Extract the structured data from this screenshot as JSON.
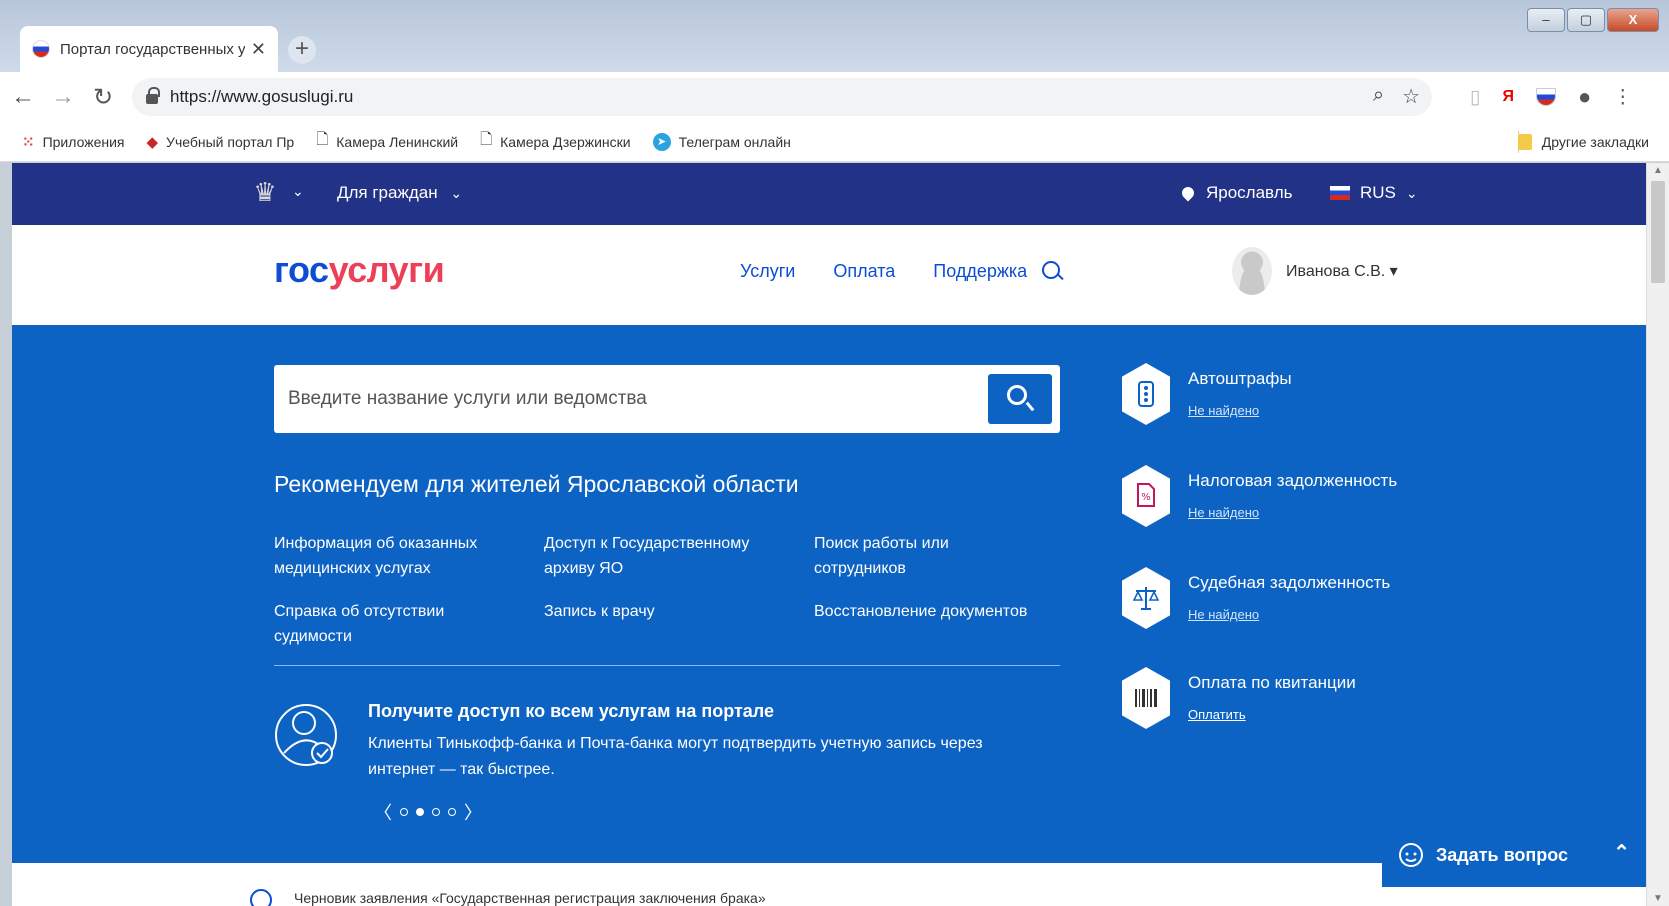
{
  "browser": {
    "tab_title": "Портал государственных услуг Р",
    "tab_close": "✕",
    "new_tab": "+",
    "url": "https://www.gosuslugi.ru",
    "window_controls": {
      "minimize": "–",
      "maximize": "▢",
      "close": "X"
    }
  },
  "bookmarks": [
    {
      "label": "Приложения",
      "icon": "apps-grid-icon"
    },
    {
      "label": "Учебный портал Пр",
      "icon": "graduation-cap-icon"
    },
    {
      "label": "Камера Ленинский",
      "icon": "document-icon"
    },
    {
      "label": "Камера Дзержински",
      "icon": "document-icon"
    },
    {
      "label": "Телеграм онлайн",
      "icon": "telegram-icon"
    }
  ],
  "other_bookmarks": "Другие закладки",
  "topbar": {
    "for_citizens": "Для граждан",
    "city": "Ярославль",
    "lang": "RUS"
  },
  "header": {
    "logo_part1": "гос",
    "logo_part2": "услуги",
    "nav": [
      "Услуги",
      "Оплата",
      "Поддержка"
    ],
    "user": "Иванова С.В. ▾"
  },
  "hero": {
    "search_placeholder": "Введите название услуги или ведомства",
    "rec_title": "Рекомендуем для жителей Ярославской области",
    "col1": [
      "Информация об оказанных медицинских услугах",
      "Справка об отсутствии судимости"
    ],
    "col2": [
      "Доступ к Государственному архиву ЯО",
      "Запись к врачу"
    ],
    "col3": [
      "Поиск работы или сотрудников",
      "Восстановление документов"
    ],
    "promo_title": "Получите доступ ко всем услугам на портале",
    "promo_text": "Клиенты Тинькофф-банка и Почта-банка могут подтвердить учетную запись через интернет — так быстрее.",
    "carousel": {
      "prev": "〈",
      "next": "〉",
      "dots": 4,
      "active": 1
    }
  },
  "sidebar": [
    {
      "title": "Автоштрафы",
      "link": "Не найдено",
      "icon": "traffic-light-icon"
    },
    {
      "title": "Налоговая задолженность",
      "link": "Не найдено",
      "icon": "tax-document-icon"
    },
    {
      "title": "Судебная задолженность",
      "link": "Не найдено",
      "icon": "scales-icon"
    },
    {
      "title": "Оплата по квитанции",
      "link": "Оплатить",
      "icon": "barcode-icon"
    }
  ],
  "bottom_text": "Черновик заявления «Государственная регистрация заключения брака»",
  "ask_button": "Задать вопрос",
  "colors": {
    "topbar": "#223286",
    "hero": "#0d63c3",
    "logo_blue": "#0d4cd3",
    "logo_red": "#ee3f58"
  }
}
